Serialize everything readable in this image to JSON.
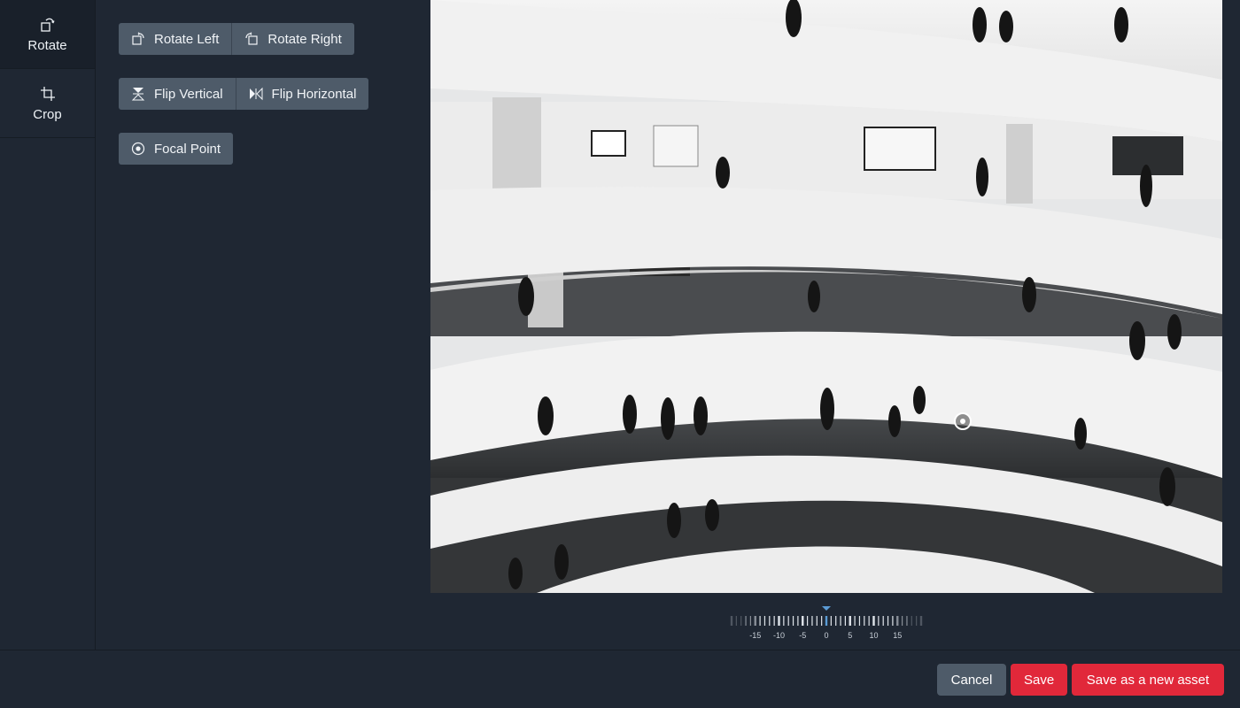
{
  "sidebar": {
    "items": [
      {
        "label": "Rotate",
        "icon": "rotate-icon",
        "active": true
      },
      {
        "label": "Crop",
        "icon": "crop-icon",
        "active": false
      }
    ]
  },
  "tools": {
    "rotate_left": "Rotate Left",
    "rotate_right": "Rotate Right",
    "flip_vertical": "Flip Vertical",
    "flip_horizontal": "Flip Horizontal",
    "focal_point": "Focal Point"
  },
  "ruler": {
    "labels": [
      "-15",
      "-10",
      "-5",
      "0",
      "5",
      "10",
      "15"
    ],
    "current_angle": 0
  },
  "footer": {
    "cancel": "Cancel",
    "save": "Save",
    "save_as_new": "Save as a new asset"
  },
  "colors": {
    "primary_red": "#e1283a",
    "button_gray": "#4e5b69",
    "background": "#1f2733",
    "ruler_indicator": "#5b9bd5"
  }
}
